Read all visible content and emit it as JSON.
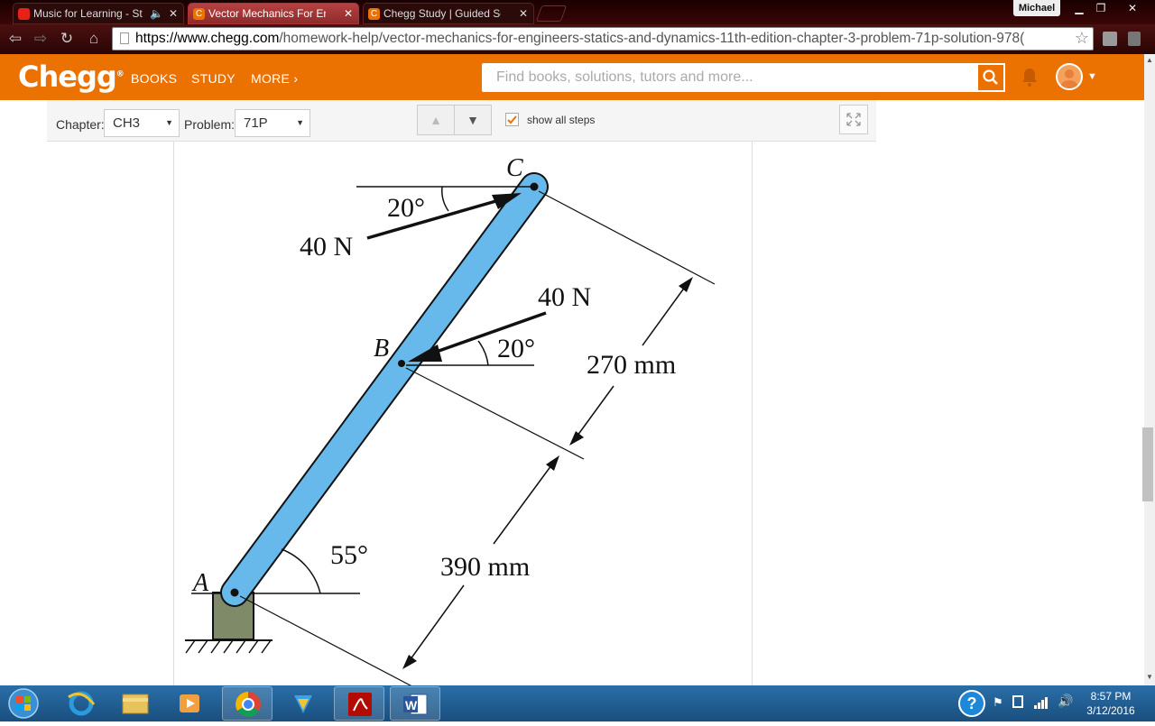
{
  "browser": {
    "tabs": [
      {
        "title": "Music for Learning - St",
        "active": false,
        "favicon_color": "#e62117"
      },
      {
        "title": "Vector Mechanics For Eng",
        "active": true,
        "favicon_color": "#eb7100"
      },
      {
        "title": "Chegg Study | Guided Sol",
        "active": false,
        "favicon_color": "#eb7100"
      }
    ],
    "user": "Michael",
    "url_domain": "https://www.chegg.com",
    "url_path": "/homework-help/vector-mechanics-for-engineers-statics-and-dynamics-11th-edition-chapter-3-problem-71p-solution-978("
  },
  "chegg": {
    "logo": "Chegg",
    "nav": [
      "BOOKS",
      "STUDY",
      "MORE"
    ],
    "search_placeholder": "Find books, solutions, tutors and more...",
    "brand_color": "#eb7100"
  },
  "subbar": {
    "chapter_label": "Chapter:",
    "chapter_value": "CH3",
    "problem_label": "Problem:",
    "problem_value": "71P",
    "show_all_steps": "show all steps",
    "show_all_checked": true
  },
  "figure": {
    "point_a": "A",
    "point_b": "B",
    "point_c": "C",
    "force_c": "40 N",
    "force_b": "40 N",
    "angle_c": "20°",
    "angle_b": "20°",
    "angle_a": "55°",
    "dim_bc": "270 mm",
    "dim_ab": "390 mm",
    "rod_color": "#66b9ea",
    "base_color": "#7f8b68"
  },
  "taskbar": {
    "time": "8:57 PM",
    "date": "3/12/2016"
  }
}
